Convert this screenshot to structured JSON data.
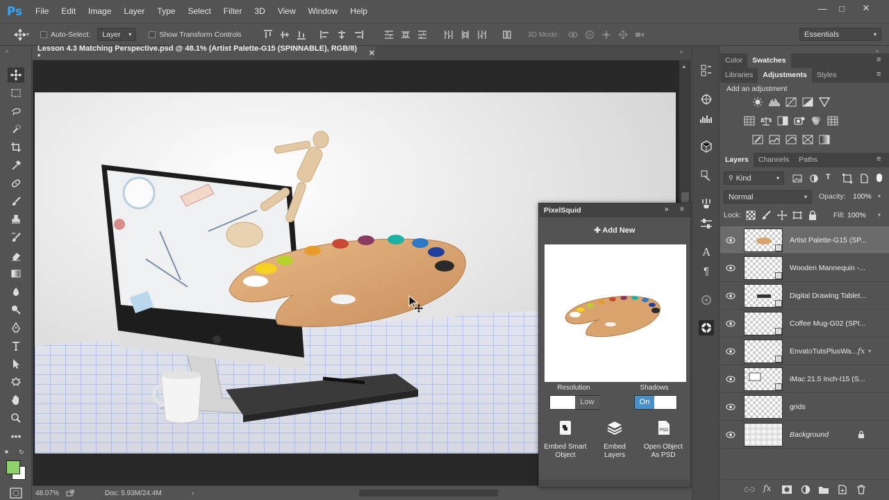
{
  "app": {
    "logo": "Ps"
  },
  "menu": [
    "File",
    "Edit",
    "Image",
    "Layer",
    "Type",
    "Select",
    "Filter",
    "3D",
    "View",
    "Window",
    "Help"
  ],
  "options": {
    "auto_select_label": "Auto-Select:",
    "auto_select_value": "Layer",
    "show_transform_label": "Show Transform Controls",
    "mode_3d_label": "3D Mode:",
    "workspace": "Essentials"
  },
  "document": {
    "tab_title": "Lesson 4.3 Matching Perspective.psd @ 48.1% (Artist Palette-G15 (SPINNABLE), RGB/8) *",
    "zoom": "48.07%",
    "doc_size": "Doc: 5.93M/24.4M"
  },
  "panels": {
    "top_tabs": [
      "Color",
      "Swatches"
    ],
    "adj_tabs": [
      "Libraries",
      "Adjustments",
      "Styles"
    ],
    "adj_title": "Add an adjustment",
    "layers_tabs": [
      "Layers",
      "Channels",
      "Paths"
    ],
    "filter_kind": "Kind",
    "blend_mode": "Normal",
    "opacity_label": "Opacity:",
    "opacity_value": "100%",
    "lock_label": "Lock:",
    "fill_label": "Fill:",
    "fill_value": "100%"
  },
  "layers": [
    {
      "name": "Artist Palette-G15 (SP..."
    },
    {
      "name": "Wooden Mannequin -..."
    },
    {
      "name": "Digital Drawing Tablet..."
    },
    {
      "name": "Coffee Mug-G02 (SPI..."
    },
    {
      "name": "EnvatoTutsPlusWa..."
    },
    {
      "name": "iMac 21.5 Inch-I15 (S..."
    },
    {
      "name": "grids"
    },
    {
      "name": "Background"
    }
  ],
  "pixelsquid": {
    "title": "PixelSquid",
    "add_new": "Add New",
    "resolution_label": "Resolution",
    "resolution_value": "Low",
    "shadows_label": "Shadows",
    "shadows_value": "On",
    "embed_smart_1": "Embed Smart",
    "embed_smart_2": "Object",
    "embed_layers_1": "Embed",
    "embed_layers_2": "Layers",
    "open_psd_1": "Open Object",
    "open_psd_2": "As PSD"
  },
  "colors": {
    "ui_bg": "#535353",
    "canvas_bg": "#282828",
    "accent": "#31a8ff",
    "foreground_swatch": "#8fd36b",
    "background_swatch": "#ffffff",
    "toggle_on": "#4a90c8"
  }
}
